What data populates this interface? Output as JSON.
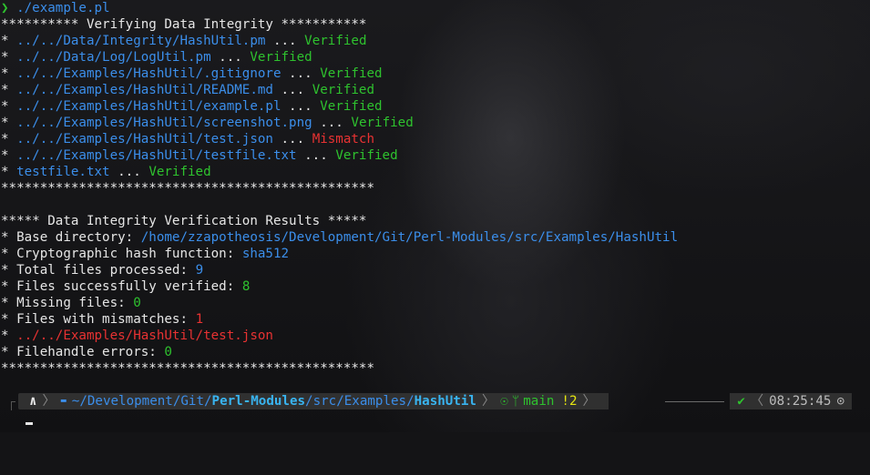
{
  "command": {
    "arrow": "❯",
    "text": "./example.pl"
  },
  "verify_header": "********** Verifying Data Integrity ***********",
  "files": [
    {
      "path": "../../Data/Integrity/HashUtil.pm",
      "sep": " ... ",
      "status": "Verified",
      "status_color": "green"
    },
    {
      "path": "../../Data/Log/LogUtil.pm",
      "sep": " ... ",
      "status": "Verified",
      "status_color": "green"
    },
    {
      "path": "../../Examples/HashUtil/.gitignore",
      "sep": " ... ",
      "status": "Verified",
      "status_color": "green"
    },
    {
      "path": "../../Examples/HashUtil/README.md",
      "sep": " ... ",
      "status": "Verified",
      "status_color": "green"
    },
    {
      "path": "../../Examples/HashUtil/example.pl",
      "sep": " ... ",
      "status": "Verified",
      "status_color": "green"
    },
    {
      "path": "../../Examples/HashUtil/screenshot.png",
      "sep": " ... ",
      "status": "Verified",
      "status_color": "green"
    },
    {
      "path": "../../Examples/HashUtil/test.json",
      "sep": " ... ",
      "status": "Mismatch",
      "status_color": "red"
    },
    {
      "path": "../../Examples/HashUtil/testfile.txt",
      "sep": " ... ",
      "status": "Verified",
      "status_color": "green"
    },
    {
      "path": "testfile.txt",
      "sep": " ... ",
      "status": "Verified",
      "status_color": "green"
    }
  ],
  "bullet": "* ",
  "rule": "************************************************",
  "results_header": "***** Data Integrity Verification Results *****",
  "results": {
    "base_dir_label": "Base directory: ",
    "base_dir_value": "/home/zzapotheosis/Development/Git/Perl-Modules/src/Examples/HashUtil",
    "hash_label": "Cryptographic hash function: ",
    "hash_value": "sha512",
    "total_label": "Total files processed: ",
    "total_value": "9",
    "verified_label": "Files successfully verified: ",
    "verified_value": "8",
    "missing_label": "Missing files: ",
    "missing_value": "0",
    "mismatch_label": "Files with mismatches: ",
    "mismatch_value": "1",
    "mismatch_file": "../../Examples/HashUtil/test.json",
    "fh_label": "Filehandle errors: ",
    "fh_value": "0"
  },
  "statusbar": {
    "os_icon": "∧",
    "folder_icon": "▬",
    "path_prefix": "~/Development/Git/",
    "path_bold1": "Perl-Modules",
    "path_mid": "/src/Examples/",
    "path_bold2": "HashUtil",
    "git_icon": "☉",
    "branch_icon": "ᛘ",
    "branch": "main",
    "changes": "!2",
    "ok_icon": "✔",
    "time": "08:25:45",
    "clock_icon": "⊙"
  },
  "colors": {
    "blue": "#3b8eea",
    "green": "#2ec22e",
    "red": "#e83232",
    "yellow": "#e5e510"
  }
}
